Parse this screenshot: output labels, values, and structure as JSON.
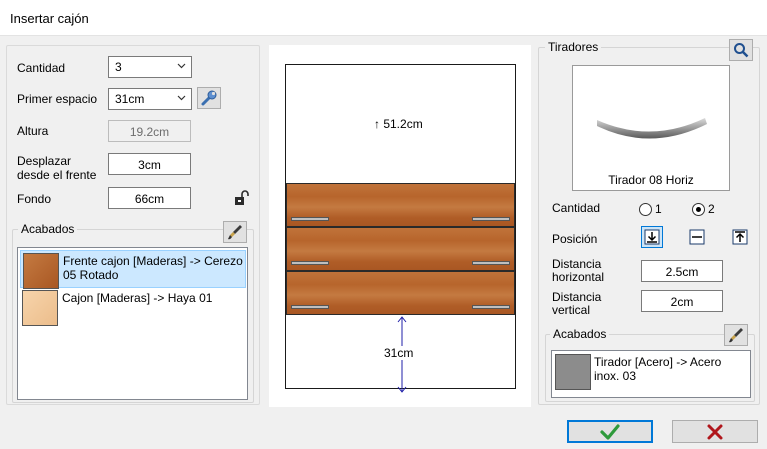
{
  "window": {
    "title": "Insertar cajón"
  },
  "left": {
    "cantidad": {
      "label": "Cantidad",
      "value": "3"
    },
    "primer_espacio": {
      "label": "Primer espacio",
      "value": "31cm"
    },
    "altura": {
      "label": "Altura",
      "value": "19.2cm"
    },
    "desplazar": {
      "label_line1": "Desplazar",
      "label_line2": "desde el frente",
      "value": "3cm"
    },
    "fondo": {
      "label": "Fondo",
      "value": "66cm"
    },
    "acabados": {
      "legend": "Acabados",
      "items": [
        {
          "text": "Frente cajon [Maderas] -> Cerezo 05 Rotado",
          "swatch": "#b86a30",
          "selected": true
        },
        {
          "text": "Cajon [Maderas] -> Haya 01",
          "swatch": "#f3c99b",
          "selected": false
        }
      ]
    }
  },
  "preview": {
    "top_dimension": "↑ 51.2cm",
    "bottom_dimension": "31cm",
    "drawer_count": 3
  },
  "right": {
    "tiradores": {
      "legend": "Tiradores",
      "image_caption": "Tirador 08 Horiz"
    },
    "cantidad": {
      "label": "Cantidad",
      "options": [
        "1",
        "2"
      ],
      "selected": "2"
    },
    "posicion": {
      "label": "Posición",
      "options": [
        "bottom",
        "center",
        "top"
      ],
      "selected": "bottom"
    },
    "distancia_horizontal": {
      "label_line1": "Distancia",
      "label_line2": "horizontal",
      "value": "2.5cm"
    },
    "distancia_vertical": {
      "label_line1": "Distancia",
      "label_line2": "vertical",
      "value": "2cm"
    },
    "acabados": {
      "legend": "Acabados",
      "item": {
        "text": "Tirador [Acero] -> Acero inox. 03",
        "swatch": "#8c8c8c"
      }
    }
  },
  "buttons": {
    "ok": "check-icon",
    "cancel": "x-icon"
  }
}
